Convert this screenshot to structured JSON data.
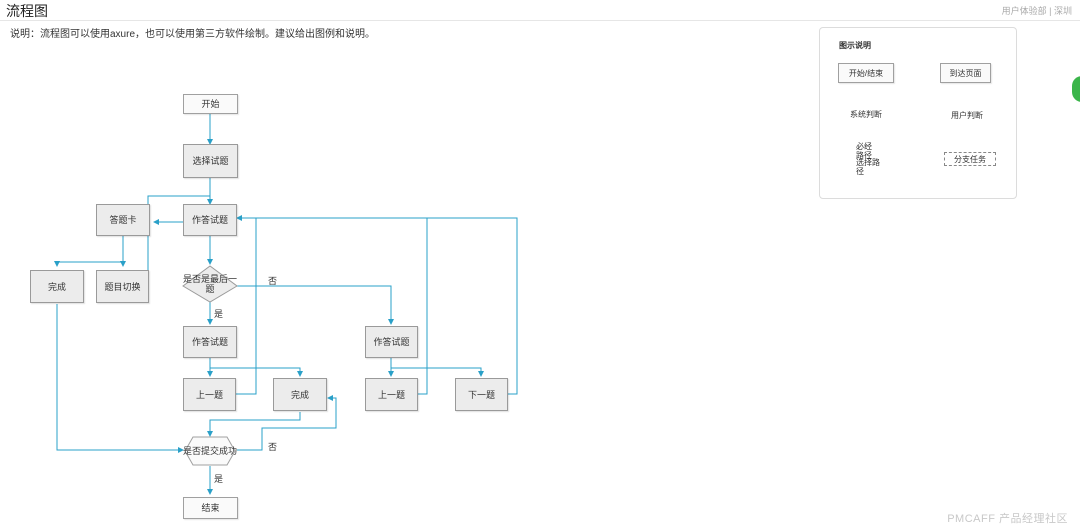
{
  "header": {
    "title": "流程图",
    "top_right": "用户体验部 | 深圳"
  },
  "description": "说明：流程图可以使用axure，也可以使用第三方软件绘制。建议给出图例和说明。",
  "flow": {
    "start": "开始",
    "select_question": "选择试题",
    "answer_card": "答题卡",
    "answer_question": "作答试题",
    "complete_left": "完成",
    "switch_question": "题目切换",
    "is_last": "是否是最后一题",
    "answer_question_2": "作答试题",
    "answer_question_3": "作答试题",
    "prev_1": "上一题",
    "complete_mid": "完成",
    "prev_2": "上一题",
    "next": "下一题",
    "submit_success": "是否提交成功",
    "end": "结束",
    "yes_1": "是",
    "no_1": "否",
    "no_2": "否",
    "yes_2": "是"
  },
  "legend": {
    "title": "图示说明",
    "start_end": "开始/结束",
    "reach_page": "到达页面",
    "system_decision": "系统判断",
    "user_decision": "用户判断",
    "required_path": "必经路径",
    "optional_path": "选择路径",
    "branch_task": "分支任务"
  },
  "watermark": "PMCAFF 产品经理社区",
  "colors": {
    "arrow": "#2aa0c8",
    "node_fill": "#ececec",
    "node_border": "#9a9a9a",
    "edge_badge": "#3bb54a"
  }
}
